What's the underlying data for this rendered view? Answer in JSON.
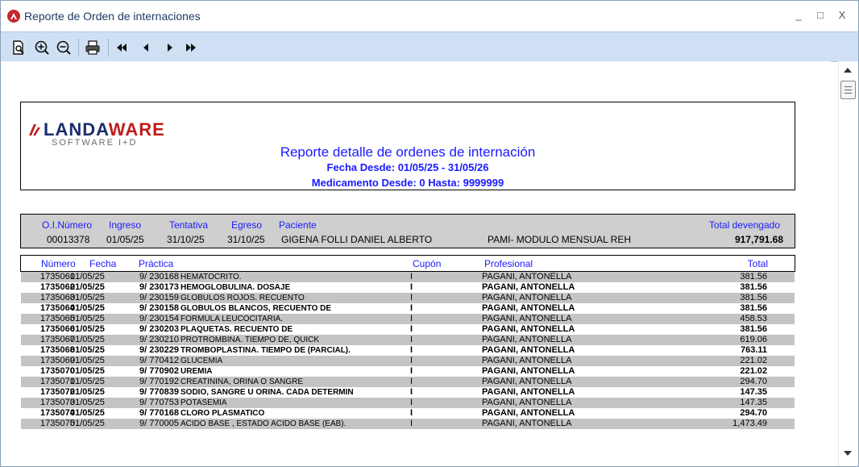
{
  "window": {
    "title": "Reporte de Orden de internaciones",
    "controls": {
      "minimize": "_",
      "maximize": "□",
      "close": "X"
    }
  },
  "toolbar": {
    "buttons": [
      {
        "name": "print-preview",
        "icon": "print-preview-icon"
      },
      {
        "name": "zoom-in",
        "icon": "zoom-in-icon"
      },
      {
        "name": "zoom-out",
        "icon": "zoom-out-icon"
      },
      {
        "name": "print",
        "icon": "printer-icon"
      },
      {
        "name": "first-page",
        "icon": "first-page-icon"
      },
      {
        "name": "previous-page",
        "icon": "previous-page-icon"
      },
      {
        "name": "next-page",
        "icon": "next-page-icon"
      },
      {
        "name": "last-page",
        "icon": "last-page-icon"
      }
    ],
    "background": "#cfe0f5"
  },
  "report": {
    "logo": {
      "brand_a": "LANDA",
      "brand_b": "WARE",
      "tagline": "SOFTWARE I+D"
    },
    "title": "Reporte detalle de ordenes de internación",
    "fecha_desde": "Fecha Desde: 01/05/25 - 31/05/26",
    "medicamento_desde": "Medicamento Desde: 0 Hasta: 9999999",
    "title_color": "#1a1aff",
    "orden": {
      "headers": {
        "numero": "O.I.Número",
        "ingreso": "Ingreso",
        "tentativa": "Tentativa",
        "egreso": "Egreso",
        "paciente": "Paciente",
        "total": "Total devengado"
      },
      "values": {
        "numero": "00013378",
        "ingreso": "01/05/25",
        "tentativa": "31/10/25",
        "egreso": "31/10/25",
        "paciente": "GIGENA FOLLI DANIEL ALBERTO",
        "obra_social": "PAMI- MODULO MENSUAL REH",
        "total": "917,791.68"
      }
    },
    "detalle": {
      "headers": {
        "numero": "Número",
        "fecha": "Fecha",
        "practica": "Práctica",
        "cupon": "Cupón",
        "profesional": "Profesional",
        "total": "Total"
      },
      "rows": [
        {
          "numero": "1735061",
          "fecha": "01/05/25",
          "practica": "9/ 230168",
          "descripcion": "HEMATOCRITO.",
          "cupon": "I",
          "profesional": "PAGANI, ANTONELLA",
          "total": "381.56"
        },
        {
          "numero": "1735062",
          "fecha": "01/05/25",
          "practica": "9/ 230173",
          "descripcion": "HEMOGLOBULINA. DOSAJE",
          "cupon": "I",
          "profesional": "PAGANI, ANTONELLA",
          "total": "381.56"
        },
        {
          "numero": "1735063",
          "fecha": "01/05/25",
          "practica": "9/ 230159",
          "descripcion": "GLOBULOS ROJOS. RECUENTO",
          "cupon": "I",
          "profesional": "PAGANI, ANTONELLA",
          "total": "381.56"
        },
        {
          "numero": "1735064",
          "fecha": "01/05/25",
          "practica": "9/ 230158",
          "descripcion": "GLOBULOS BLANCOS, RECUENTO DE",
          "cupon": "I",
          "profesional": "PAGANI, ANTONELLA",
          "total": "381.56"
        },
        {
          "numero": "1735065",
          "fecha": "01/05/25",
          "practica": "9/ 230154",
          "descripcion": "FORMULA LEUCOCITARIA.",
          "cupon": "I",
          "profesional": "PAGANI, ANTONELLA",
          "total": "458.53"
        },
        {
          "numero": "1735066",
          "fecha": "01/05/25",
          "practica": "9/ 230203",
          "descripcion": "PLAQUETAS. RECUENTO DE",
          "cupon": "I",
          "profesional": "PAGANI, ANTONELLA",
          "total": "381.56"
        },
        {
          "numero": "1735067",
          "fecha": "01/05/25",
          "practica": "9/ 230210",
          "descripcion": "PROTROMBINA. TIEMPO DE, QUICK",
          "cupon": "I",
          "profesional": "PAGANI, ANTONELLA",
          "total": "619.06"
        },
        {
          "numero": "1735068",
          "fecha": "01/05/25",
          "practica": "9/ 230229",
          "descripcion": "TROMBOPLASTINA. TIEMPO DE (PARCIAL).",
          "cupon": "I",
          "profesional": "PAGANI, ANTONELLA",
          "total": "763.11"
        },
        {
          "numero": "1735069",
          "fecha": "01/05/25",
          "practica": "9/ 770412",
          "descripcion": "GLUCEMIA",
          "cupon": "I",
          "profesional": "PAGANI, ANTONELLA",
          "total": "221.02"
        },
        {
          "numero": "1735070",
          "fecha": "01/05/25",
          "practica": "9/ 770902",
          "descripcion": "UREMIA",
          "cupon": "I",
          "profesional": "PAGANI, ANTONELLA",
          "total": "221.02"
        },
        {
          "numero": "1735071",
          "fecha": "01/05/25",
          "practica": "9/ 770192",
          "descripcion": "CREATININA, ORINA O SANGRE",
          "cupon": "I",
          "profesional": "PAGANI, ANTONELLA",
          "total": "294.70"
        },
        {
          "numero": "1735072",
          "fecha": "01/05/25",
          "practica": "9/ 770839",
          "descripcion": "SODIO, SANGRE U ORINA. CADA DETERMIN",
          "cupon": "I",
          "profesional": "PAGANI, ANTONELLA",
          "total": "147.35"
        },
        {
          "numero": "1735073",
          "fecha": "01/05/25",
          "practica": "9/ 770753",
          "descripcion": "POTASEMIA",
          "cupon": "I",
          "profesional": "PAGANI, ANTONELLA",
          "total": "147.35"
        },
        {
          "numero": "1735074",
          "fecha": "01/05/25",
          "practica": "9/ 770168",
          "descripcion": "CLORO PLASMATICO",
          "cupon": "I",
          "profesional": "PAGANI, ANTONELLA",
          "total": "294.70"
        },
        {
          "numero": "1735075",
          "fecha": "01/05/25",
          "practica": "9/ 770005",
          "descripcion": "ACIDO BASE , ESTADO ACIDO BASE (EAB).",
          "cupon": "I",
          "profesional": "PAGANI, ANTONELLA",
          "total": "1,473.49"
        }
      ]
    }
  }
}
